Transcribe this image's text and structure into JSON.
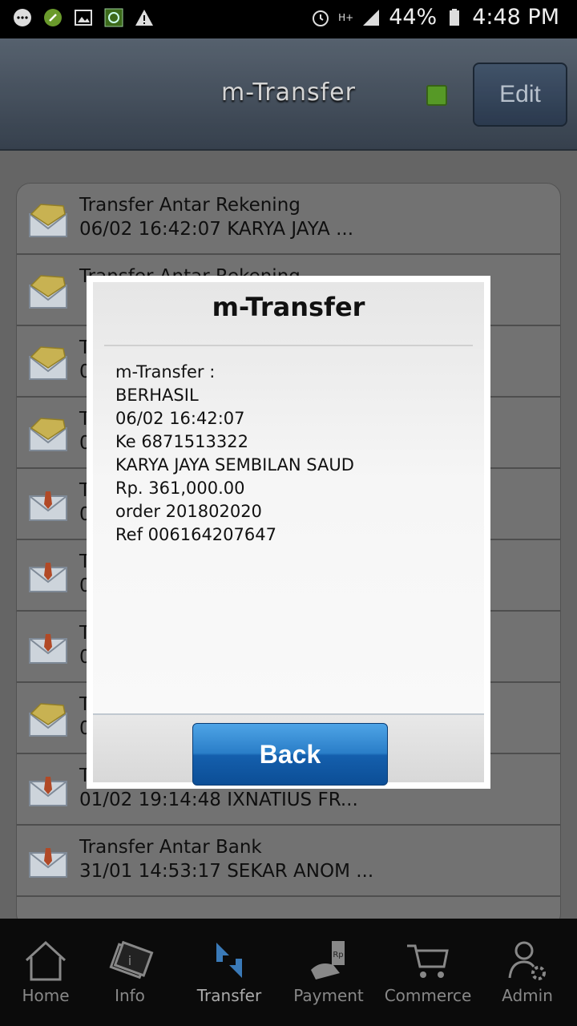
{
  "status_bar": {
    "battery": "44%",
    "time": "4:48 PM",
    "network": "H+",
    "icons": [
      "chat-icon",
      "vpn-icon",
      "image-icon",
      "app-icon",
      "warning-icon",
      "alarm-icon",
      "signal-icon",
      "battery-icon"
    ]
  },
  "header": {
    "title": "m-Transfer",
    "edit_label": "Edit",
    "indicator_color": "#5ea72a"
  },
  "list": {
    "items": [
      {
        "title": "Transfer Antar Rekening",
        "subtitle": "06/02 16:42:07 KARYA JAYA ...",
        "icon": "read-envelope-icon"
      },
      {
        "title": "Transfer Antar Rekening",
        "subtitle": "",
        "icon": "read-envelope-icon"
      },
      {
        "title": "T",
        "subtitle": "0",
        "icon": "read-envelope-icon"
      },
      {
        "title": "T",
        "subtitle": "0",
        "icon": "read-envelope-icon"
      },
      {
        "title": "Tr",
        "subtitle": "0",
        "icon": "unread-envelope-icon"
      },
      {
        "title": "Tr",
        "subtitle": "0",
        "icon": "unread-envelope-icon"
      },
      {
        "title": "Tr",
        "subtitle": "0",
        "icon": "unread-envelope-icon"
      },
      {
        "title": "T",
        "subtitle": "0",
        "icon": "read-envelope-icon"
      },
      {
        "title": "Tr",
        "subtitle": "01/02 19:14:48 IXNATIUS FR...",
        "icon": "unread-envelope-icon"
      },
      {
        "title": "Transfer Antar Bank",
        "subtitle": "31/01 14:53:17 SEKAR ANOM ...",
        "icon": "unread-envelope-icon"
      }
    ]
  },
  "modal": {
    "title": "m-Transfer",
    "lines": [
      "m-Transfer :",
      "BERHASIL",
      "06/02 16:42:07",
      "Ke 6871513322",
      "KARYA JAYA SEMBILAN SAUD",
      "Rp. 361,000.00",
      "order 201802020",
      "Ref 006164207647"
    ],
    "back_label": "Back"
  },
  "bottom_nav": {
    "items": [
      {
        "label": "Home",
        "icon": "home-icon"
      },
      {
        "label": "Info",
        "icon": "info-icon"
      },
      {
        "label": "Transfer",
        "icon": "transfer-icon"
      },
      {
        "label": "Payment",
        "icon": "payment-icon"
      },
      {
        "label": "Commerce",
        "icon": "cart-icon"
      },
      {
        "label": "Admin",
        "icon": "admin-icon"
      }
    ],
    "active": "Transfer"
  }
}
